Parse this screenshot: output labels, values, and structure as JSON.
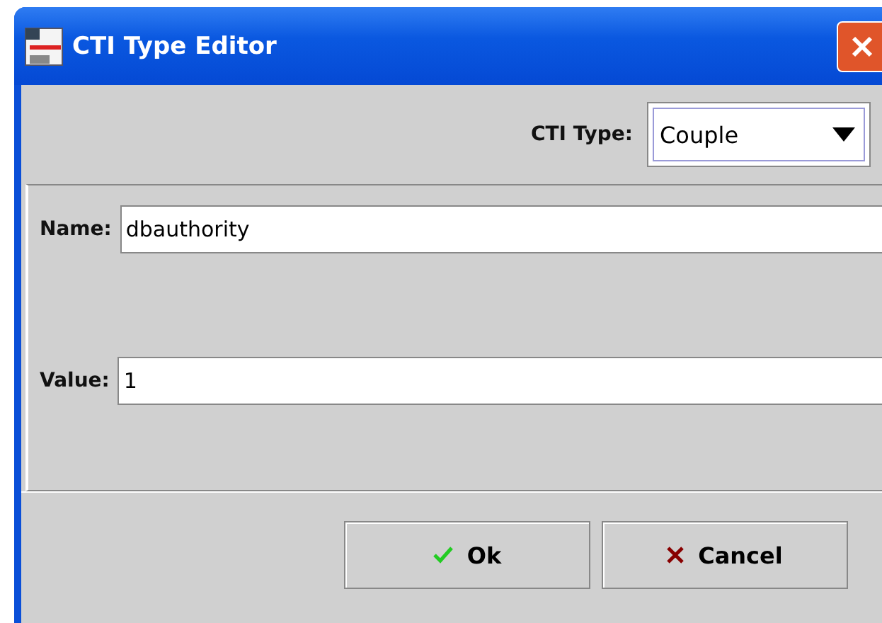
{
  "window": {
    "title": "CTI Type Editor"
  },
  "cti_type": {
    "label": "CTI Type:",
    "value": "Couple"
  },
  "fields": [
    {
      "label": "Name:",
      "value": "dbauthority"
    },
    {
      "label": "Value:",
      "value": "1"
    }
  ],
  "buttons": [
    {
      "kind": "ok",
      "label": "Ok"
    },
    {
      "kind": "cancel",
      "label": "Cancel"
    }
  ]
}
